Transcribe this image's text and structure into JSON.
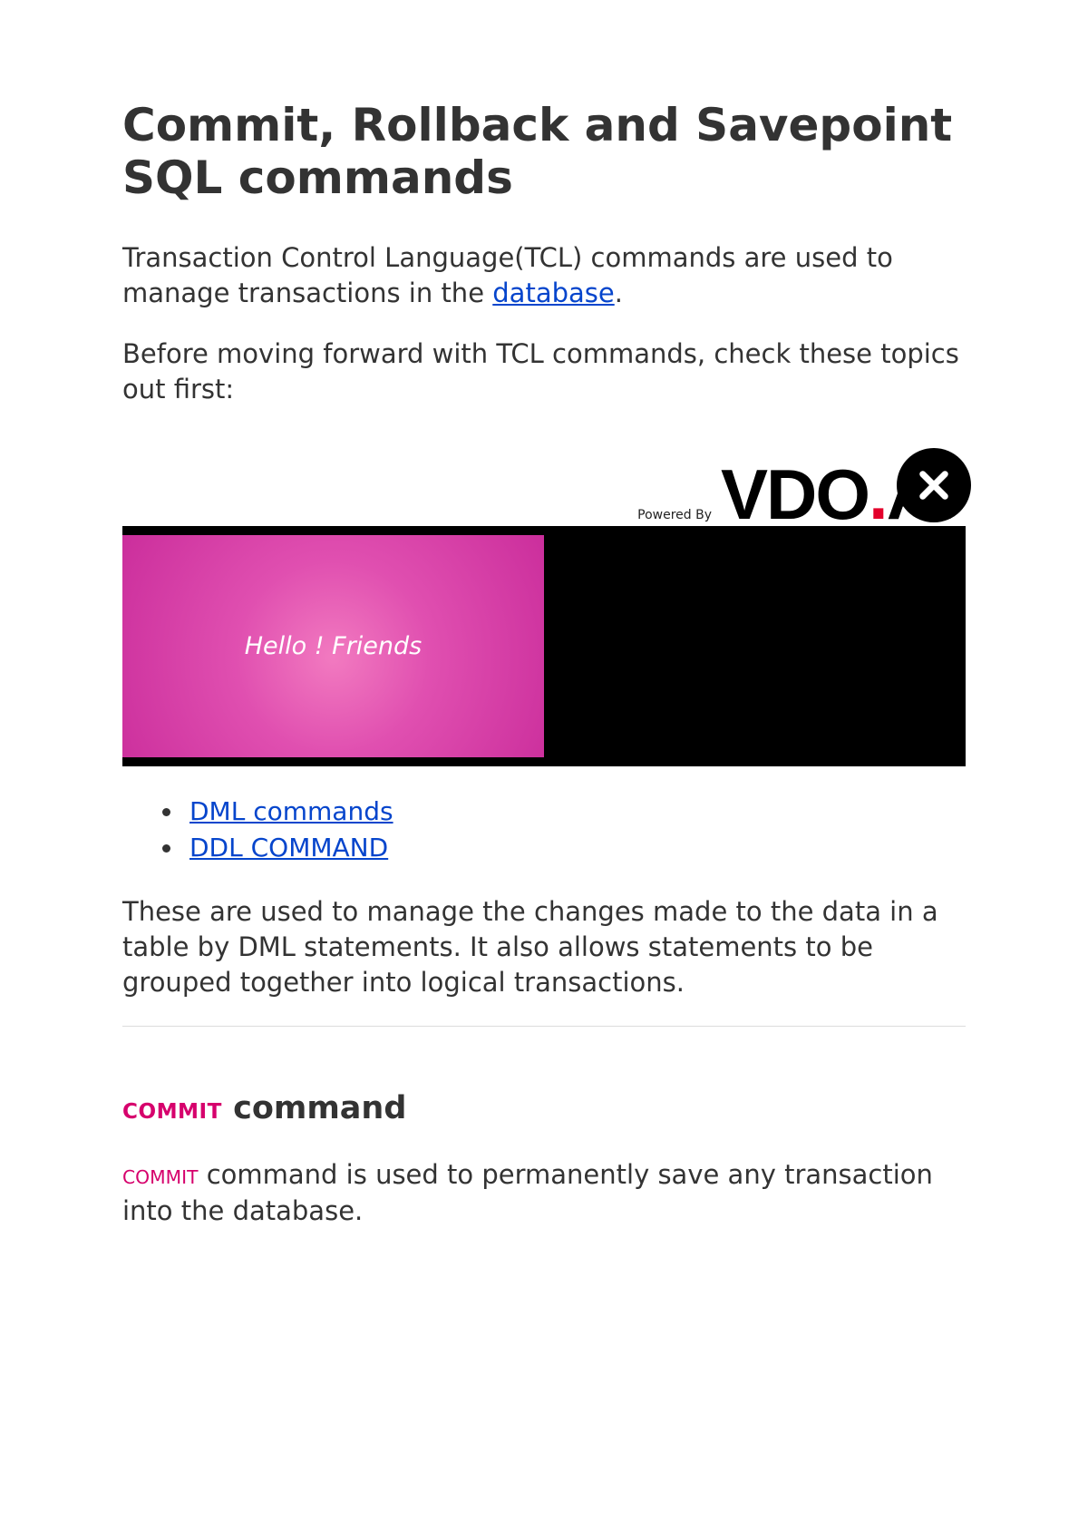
{
  "title": "Commit, Rollback and Savepoint SQL commands",
  "intro1_pre": "Transaction Control Language(TCL) commands are used to manage transactions in the ",
  "intro1_link": "database",
  "intro1_post": ".",
  "intro2": "Before moving forward with TCL commands, check these topics out first:",
  "ad": {
    "powered": "Powered By",
    "brand_pre": "VDO",
    "brand_post": "AI",
    "slide_text": "Hello ! Friends"
  },
  "links": [
    "DML commands",
    "DDL COMMAND"
  ],
  "para3": "These are used to manage the changes made to the data in a table by DML statements. It also allows statements to be grouped together into logical transactions.",
  "section": {
    "kw": "COMMIT",
    "rest": " command"
  },
  "para4_kw": "COMMIT",
  "para4_rest": " command is used to permanently save any transaction into the database."
}
